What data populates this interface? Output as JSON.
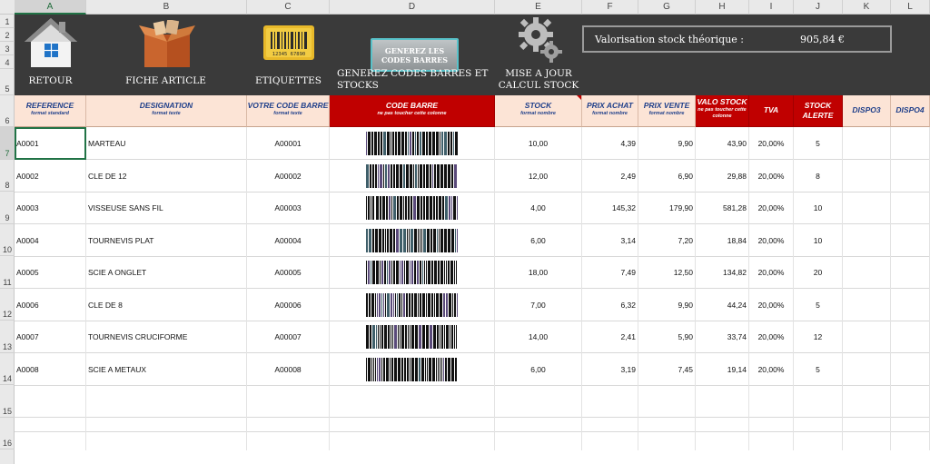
{
  "sheet": {
    "columns": [
      "A",
      "B",
      "C",
      "D",
      "E",
      "F",
      "G",
      "H",
      "I",
      "J",
      "K",
      "L"
    ],
    "rows": [
      "1",
      "2",
      "3",
      "4",
      "5",
      "6",
      "7",
      "8",
      "9",
      "10",
      "11",
      "12",
      "13",
      "14",
      "15",
      "16"
    ]
  },
  "banner": {
    "retour_label": "RETOUR",
    "fiche_label": "FICHE ARTICLE",
    "etiquettes_label": "ETIQUETTES",
    "etiquettes_barcode_text": "12345 67890",
    "generate_button": "GENEREZ LES CODES BARRES",
    "generate_caption": "GENEREZ CODES BARRES ET STOCKS",
    "maj_caption": "MISE A JOUR CALCUL STOCK",
    "valo_label": "Valorisation stock théorique :",
    "valo_value": "905,84 €"
  },
  "headers": {
    "reference": "REFERENCE",
    "reference_sub": "format standard",
    "designation": "DESIGNATION",
    "designation_sub": "format texte",
    "code": "VOTRE CODE BARRE",
    "code_sub": "format texte",
    "barcode": "CODE BARRE",
    "barcode_sub": "ne pas toucher cette colonne",
    "stock": "STOCK",
    "stock_sub": "format nombre",
    "achat": "PRIX ACHAT",
    "achat_sub": "format nombre",
    "vente": "PRIX VENTE",
    "vente_sub": "format nombre",
    "valo": "VALO STOCK",
    "valo_sub": "ne pas toucher cette colonne",
    "tva": "TVA",
    "alerte": "STOCK ALERTE",
    "dispo3": "DISPO3",
    "dispo4": "DISPO4"
  },
  "items": [
    {
      "ref": "A0001",
      "designation": "MARTEAU",
      "code": "A00001",
      "stock": "10,00",
      "achat": "4,39",
      "vente": "9,90",
      "valo": "43,90",
      "tva": "20,00%",
      "alerte": "5"
    },
    {
      "ref": "A0002",
      "designation": "CLE DE 12",
      "code": "A00002",
      "stock": "12,00",
      "achat": "2,49",
      "vente": "6,90",
      "valo": "29,88",
      "tva": "20,00%",
      "alerte": "8"
    },
    {
      "ref": "A0003",
      "designation": "VISSEUSE SANS FIL",
      "code": "A00003",
      "stock": "4,00",
      "achat": "145,32",
      "vente": "179,90",
      "valo": "581,28",
      "tva": "20,00%",
      "alerte": "10"
    },
    {
      "ref": "A0004",
      "designation": "TOURNEVIS PLAT",
      "code": "A00004",
      "stock": "6,00",
      "achat": "3,14",
      "vente": "7,20",
      "valo": "18,84",
      "tva": "20,00%",
      "alerte": "10"
    },
    {
      "ref": "A0005",
      "designation": "SCIE A ONGLET",
      "code": "A00005",
      "stock": "18,00",
      "achat": "7,49",
      "vente": "12,50",
      "valo": "134,82",
      "tva": "20,00%",
      "alerte": "20"
    },
    {
      "ref": "A0006",
      "designation": "CLE DE 8",
      "code": "A00006",
      "stock": "7,00",
      "achat": "6,32",
      "vente": "9,90",
      "valo": "44,24",
      "tva": "20,00%",
      "alerte": "5"
    },
    {
      "ref": "A0007",
      "designation": "TOURNEVIS CRUCIFORME",
      "code": "A00007",
      "stock": "14,00",
      "achat": "2,41",
      "vente": "5,90",
      "valo": "33,74",
      "tva": "20,00%",
      "alerte": "12"
    },
    {
      "ref": "A0008",
      "designation": "SCIE A METAUX",
      "code": "A00008",
      "stock": "6,00",
      "achat": "3,19",
      "vente": "7,45",
      "valo": "19,14",
      "tva": "20,00%",
      "alerte": "5"
    }
  ],
  "colors": {
    "banner_bg": "#3a3a3a",
    "header_light": "#fce4d6",
    "header_red": "#c00000",
    "header_text": "#1f3f8a",
    "selection_green": "#217346"
  },
  "icons": [
    "house-icon",
    "box-icon",
    "barcode-label-icon",
    "gears-icon"
  ]
}
